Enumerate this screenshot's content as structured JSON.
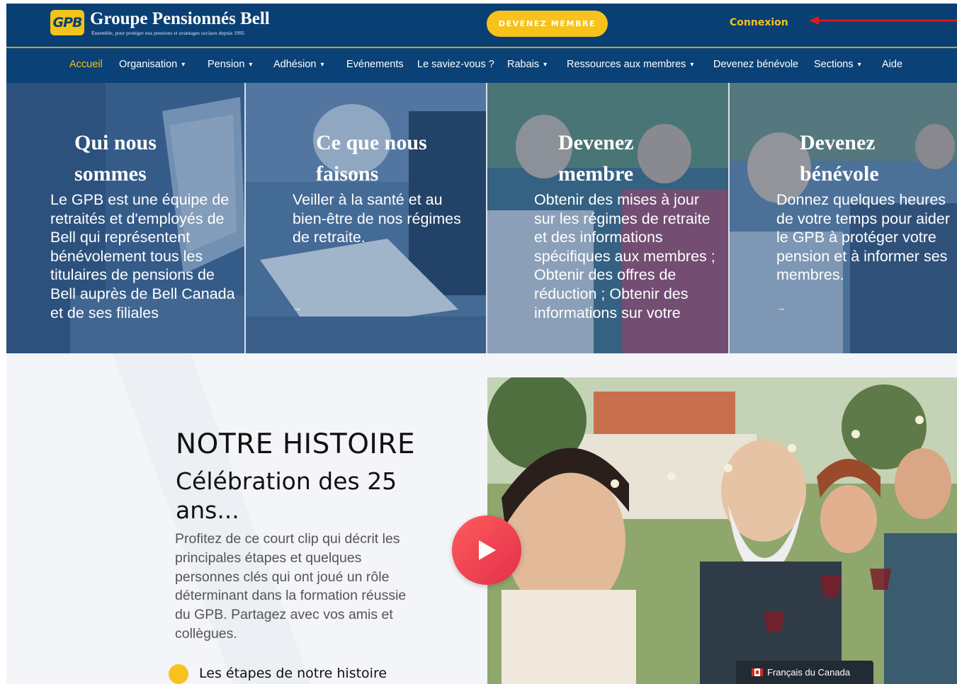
{
  "header": {
    "logo_text": "GPB",
    "brand_name": "Groupe Pensionnés Bell",
    "tagline": "Ensemble, pour protéger nos pensions et avantages sociaux depuis 1995",
    "member_button": "DEVENEZ MEMBRE",
    "login_link": "Connexion"
  },
  "nav": {
    "items": [
      {
        "label": "Accueil",
        "dropdown": false
      },
      {
        "label": "Organisation",
        "dropdown": true
      },
      {
        "label": "Pension",
        "dropdown": true
      },
      {
        "label": "Adhésion",
        "dropdown": true
      },
      {
        "label": "Evénements",
        "dropdown": false
      },
      {
        "label": "Le saviez-vous ?",
        "dropdown": false
      },
      {
        "label": "Rabais",
        "dropdown": true
      },
      {
        "label": "Ressources aux membres",
        "dropdown": true
      },
      {
        "label": "Devenez bénévole",
        "dropdown": false
      },
      {
        "label": "Sections",
        "dropdown": true
      },
      {
        "label": "Aide",
        "dropdown": false
      }
    ],
    "chevron": "⌄"
  },
  "hero": {
    "panels": [
      {
        "title": "Qui nous\nsommes",
        "text": "Le GPB est une équipe de retraités et d'employés de Bell qui représentent bénévolement tous les titulaires de pensions de Bell auprès de Bell Canada et de ses filiales",
        "arrow": ""
      },
      {
        "title": "Ce que nous\nfaisons",
        "text": "Veiller à la santé et au bien-être de nos régimes de retraite.",
        "arrow": "→"
      },
      {
        "title": "Devenez\nmembre",
        "text": "Obtenir des mises à jour sur les régimes de retraite et des informations spécifiques aux membres ; Obtenir des offres de réduction ; Obtenir des informations sur votre",
        "arrow": ""
      },
      {
        "title": "Devenez\nbénévole",
        "text": "Donnez quelques heures de votre temps pour aider le GPB à protéger votre pension et à informer ses membres.",
        "arrow": "→"
      }
    ]
  },
  "story": {
    "heading": "NOTRE HISTOIRE",
    "subheading": "Célébration des 25 ans...",
    "paragraph": "Profitez de ce court clip qui décrit les principales étapes et quelques personnes clés qui ont joué un rôle déterminant dans la formation réussie du GPB. Partagez avec vos amis et collègues.",
    "bullet": "Les étapes de notre histoire"
  },
  "language": {
    "label": "Français du Canada"
  },
  "colors": {
    "header_bg": "#0a3f73",
    "nav_bg": "#0a4177",
    "accent_yellow": "#f7c21b",
    "play_red": "#e2304a",
    "annotation_red": "#e01a1a"
  },
  "icons": [
    "chevron-down-icon",
    "arrow-right-icon",
    "play-icon",
    "canada-flag-icon",
    "red-annotation-arrow"
  ]
}
